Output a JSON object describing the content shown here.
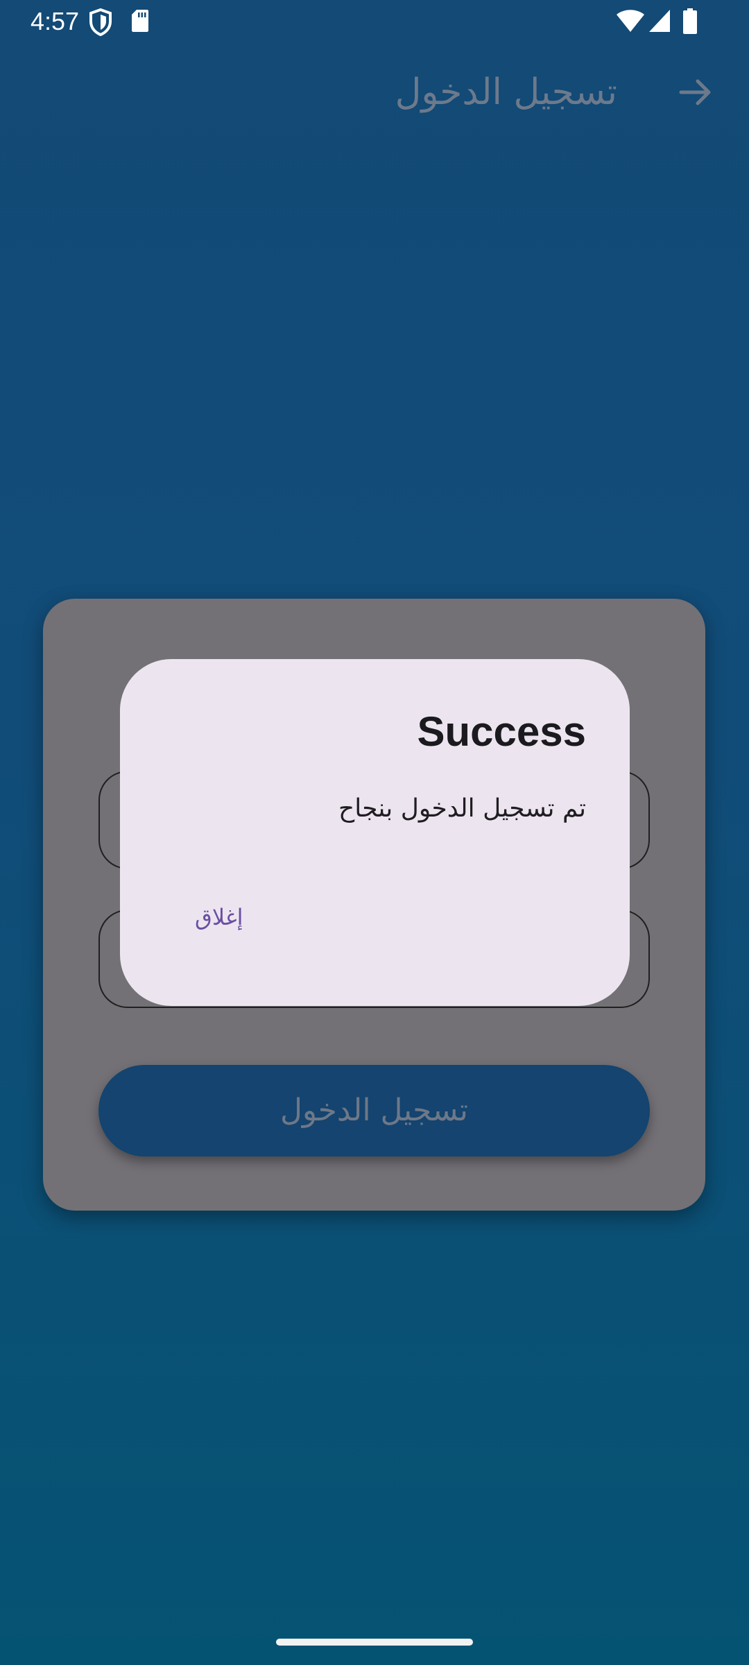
{
  "status_bar": {
    "time": "4:57",
    "icons": [
      "shield-icon",
      "sd-card-icon",
      "wifi-icon",
      "signal-icon",
      "battery-icon"
    ]
  },
  "app_bar": {
    "title": "تسجيل الدخول",
    "back_icon": "arrow-icon"
  },
  "login_card": {
    "login_button_label": "تسجيل الدخول"
  },
  "dialog": {
    "title": "Success",
    "message": "تم تسجيل الدخول بنجاح",
    "close_label": "إغلاق"
  },
  "colors": {
    "background_top": "#134a76",
    "background_bottom": "#055373",
    "card": "#737176",
    "dialog": "#ece5f0",
    "accent": "#6a4fa2",
    "button": "#14446f"
  }
}
